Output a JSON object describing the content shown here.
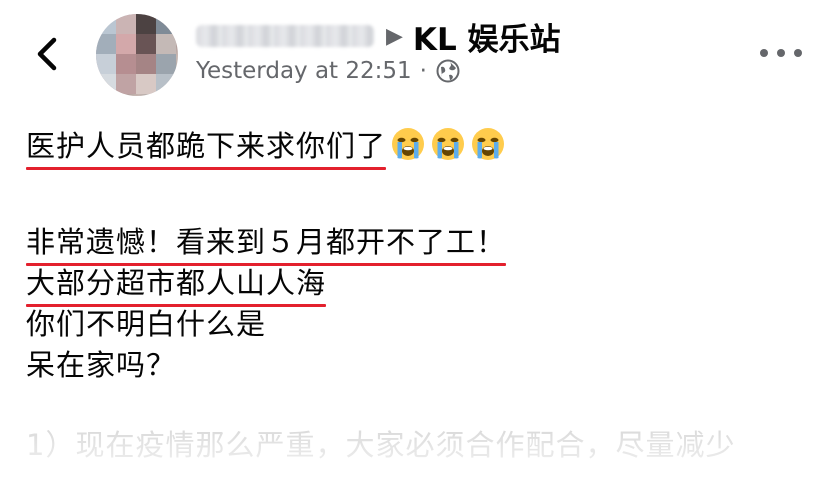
{
  "header": {
    "author_name_blurred": "",
    "separator": "▶",
    "group_name": "KL 娱乐站",
    "timestamp": "Yesterday at 22:51",
    "dot": "·",
    "privacy_icon": "globe-icon",
    "back_icon": "chevron-left-icon",
    "more_icon": "more-horizontal-icon"
  },
  "post": {
    "line1": "医护人员都跪下来求你们了",
    "emoji": "loudly-crying-face",
    "emoji_count": 3,
    "line2": "非常遗憾！看来到５月都开不了工！",
    "line3": "大部分超市都人山人海",
    "line4": "你们不明白什么是",
    "line5": "呆在家吗？",
    "line6": "1）现在疫情那么严重，大家必须合作配合，尽量减少"
  },
  "colors": {
    "underline": "#e3202d",
    "meta_text": "#65676b",
    "body_text": "#050505"
  }
}
